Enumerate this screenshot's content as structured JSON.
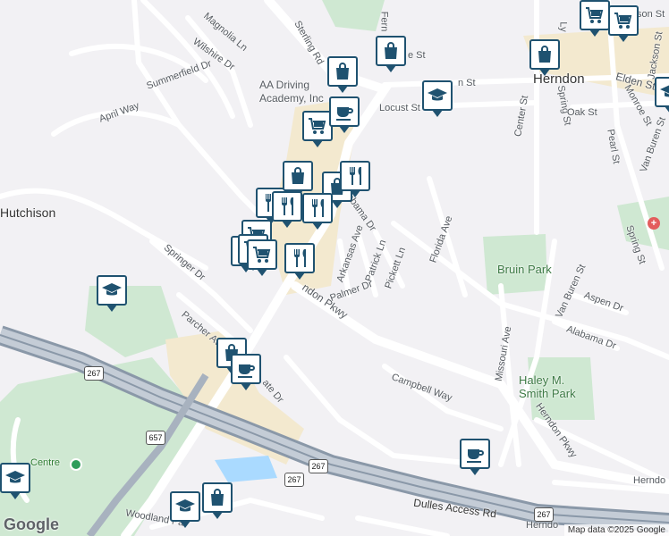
{
  "labels": {
    "sterling_rd": "Sterling Rd",
    "magnolia_ln": "Magnolia Ln",
    "wilshire_dr": "Wilshire Dr",
    "summerfield_dr": "Summerfield Dr",
    "april_way": "April Way",
    "hutchison": "Hutchison",
    "springer_dr": "Springer Dr",
    "parcher_av": "Parcher Av",
    "aa_driving": "AA Driving\nAcademy, Inc",
    "ferndale": "Fern",
    "st_top": "e St",
    "n_st": "n St",
    "locust_st": "Locust St",
    "herndon": "Herndon",
    "elden_st": "Elden St",
    "jackson_st_top": "son St",
    "center_st": "Center St",
    "spring_st_v": "Spring St",
    "oak_st": "Oak St",
    "lynn": "Ly",
    "jackson_st": "Jackson St",
    "monroe_st": "Monroe St",
    "pearl_st": "Pearl St",
    "van_buren_st_e": "Van Buren St",
    "spring_st": "Spring St",
    "alabama_dr_top": "Alabama Dr",
    "arkansas_ave": "Arkansas Ave",
    "patrick_ln": "Patrick Ln",
    "pickett_ln": "Pickett Ln",
    "florida_ave": "Florida Ave",
    "bruin_park": "Bruin Park",
    "palmer_dr": "Palmer Dr",
    "herndon_pkwy": "ndon Pkwy",
    "van_buren_st": "Van Buren St",
    "aspen_dr": "Aspen Dr",
    "missouri_ave": "Missouri Ave",
    "alabama_dr": "Alabama Dr",
    "haley_park": "Haley M.\nSmith Park",
    "campbell_way": "Campbell Way",
    "herndon_pkwy_2": "Herndon Pkwy",
    "herndon_right": "Herndo",
    "gate_dr": "ate Dr",
    "centre": "Centre",
    "woodland_pa": "Woodland Pa",
    "dulles_access": "Dulles Access Rd",
    "herndon_bottom": "Herndo"
  },
  "shields": [
    "267",
    "657",
    "267",
    "267",
    "267"
  ],
  "google_logo": "Google",
  "attribution": "Map data ©2025 Google",
  "pins": [
    {
      "type": "shopping-bag",
      "name": "shop-pin"
    },
    {
      "type": "shopping-bag",
      "name": "shop-pin"
    },
    {
      "type": "shopping-bag",
      "name": "shop-pin"
    },
    {
      "type": "shopping-cart",
      "name": "grocery-pin"
    },
    {
      "type": "shopping-cart",
      "name": "grocery-pin"
    },
    {
      "type": "shopping-cart",
      "name": "grocery-pin"
    },
    {
      "type": "coffee-cup",
      "name": "cafe-pin"
    },
    {
      "type": "coffee-cup",
      "name": "cafe-pin"
    },
    {
      "type": "coffee-cup",
      "name": "cafe-pin"
    },
    {
      "type": "graduation-cap",
      "name": "school-pin"
    },
    {
      "type": "graduation-cap",
      "name": "school-pin"
    },
    {
      "type": "graduation-cap",
      "name": "school-pin"
    },
    {
      "type": "fork-knife",
      "name": "restaurant-pin"
    },
    {
      "type": "fork-knife",
      "name": "restaurant-pin"
    },
    {
      "type": "fork-knife",
      "name": "restaurant-pin"
    },
    {
      "type": "fork-knife",
      "name": "restaurant-pin"
    }
  ],
  "colors": {
    "pin_border": "#1f5270",
    "park": "#c8e6c9",
    "highway": "#8a98a8",
    "commercial": "#f5ecd6"
  }
}
